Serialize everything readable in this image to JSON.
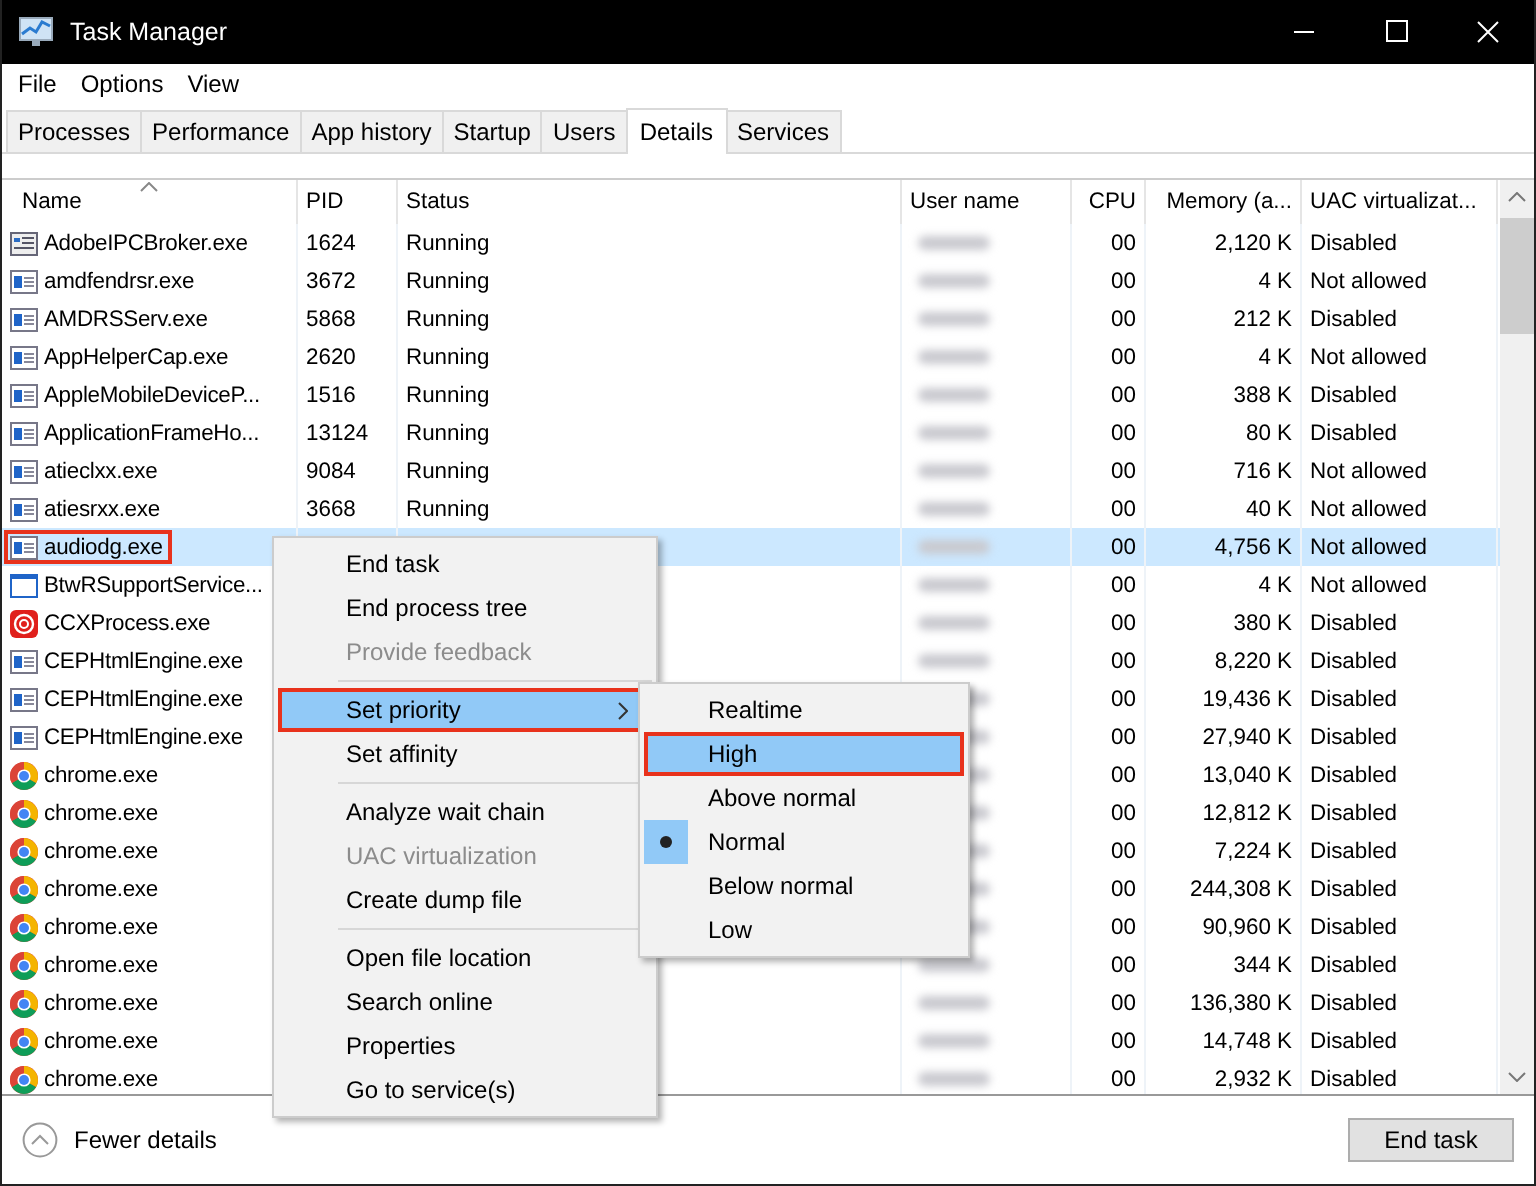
{
  "window": {
    "title": "Task Manager"
  },
  "menu_bar": [
    "File",
    "Options",
    "View"
  ],
  "tabs": [
    {
      "label": "Processes",
      "selected": false
    },
    {
      "label": "Performance",
      "selected": false
    },
    {
      "label": "App history",
      "selected": false
    },
    {
      "label": "Startup",
      "selected": false
    },
    {
      "label": "Users",
      "selected": false
    },
    {
      "label": "Details",
      "selected": true
    },
    {
      "label": "Services",
      "selected": false
    }
  ],
  "table": {
    "columns": [
      {
        "label": "Name",
        "sorted": true
      },
      {
        "label": "PID",
        "sorted": false
      },
      {
        "label": "Status",
        "sorted": false
      },
      {
        "label": "User name",
        "sorted": false
      },
      {
        "label": "CPU",
        "sorted": false
      },
      {
        "label": "Memory (a...",
        "sorted": false
      },
      {
        "label": "UAC virtualizat...",
        "sorted": false
      }
    ],
    "rows": [
      {
        "kind": "service",
        "name": "AdobeIPCBroker.exe",
        "pid": "1624",
        "status": "Running",
        "cpu": "00",
        "memory": "2,120 K",
        "uac": "Disabled",
        "selected": false,
        "outlined": false
      },
      {
        "kind": "app",
        "name": "amdfendrsr.exe",
        "pid": "3672",
        "status": "Running",
        "cpu": "00",
        "memory": "4 K",
        "uac": "Not allowed",
        "selected": false,
        "outlined": false
      },
      {
        "kind": "app",
        "name": "AMDRSServ.exe",
        "pid": "5868",
        "status": "Running",
        "cpu": "00",
        "memory": "212 K",
        "uac": "Disabled",
        "selected": false,
        "outlined": false
      },
      {
        "kind": "app",
        "name": "AppHelperCap.exe",
        "pid": "2620",
        "status": "Running",
        "cpu": "00",
        "memory": "4 K",
        "uac": "Not allowed",
        "selected": false,
        "outlined": false
      },
      {
        "kind": "app",
        "name": "AppleMobileDeviceP...",
        "pid": "1516",
        "status": "Running",
        "cpu": "00",
        "memory": "388 K",
        "uac": "Disabled",
        "selected": false,
        "outlined": false
      },
      {
        "kind": "app",
        "name": "ApplicationFrameHo...",
        "pid": "13124",
        "status": "Running",
        "cpu": "00",
        "memory": "80 K",
        "uac": "Disabled",
        "selected": false,
        "outlined": false
      },
      {
        "kind": "app",
        "name": "atieclxx.exe",
        "pid": "9084",
        "status": "Running",
        "cpu": "00",
        "memory": "716 K",
        "uac": "Not allowed",
        "selected": false,
        "outlined": false
      },
      {
        "kind": "app",
        "name": "atiesrxx.exe",
        "pid": "3668",
        "status": "Running",
        "cpu": "00",
        "memory": "40 K",
        "uac": "Not allowed",
        "selected": false,
        "outlined": false
      },
      {
        "kind": "app",
        "name": "audiodg.exe",
        "cpu": "00",
        "memory": "4,756 K",
        "uac": "Not allowed",
        "selected": true,
        "outlined": true
      },
      {
        "kind": "window",
        "name": "BtwRSupportService...",
        "cpu": "00",
        "memory": "4 K",
        "uac": "Not allowed",
        "selected": false,
        "outlined": false
      },
      {
        "kind": "ccx",
        "name": "CCXProcess.exe",
        "cpu": "00",
        "memory": "380 K",
        "uac": "Disabled",
        "selected": false,
        "outlined": false
      },
      {
        "kind": "app",
        "name": "CEPHtmlEngine.exe",
        "cpu": "00",
        "memory": "8,220 K",
        "uac": "Disabled",
        "selected": false,
        "outlined": false
      },
      {
        "kind": "app",
        "name": "CEPHtmlEngine.exe",
        "cpu": "00",
        "memory": "19,436 K",
        "uac": "Disabled",
        "selected": false,
        "outlined": false
      },
      {
        "kind": "app",
        "name": "CEPHtmlEngine.exe",
        "cpu": "00",
        "memory": "27,940 K",
        "uac": "Disabled",
        "selected": false,
        "outlined": false
      },
      {
        "kind": "chrome",
        "name": "chrome.exe",
        "cpu": "00",
        "memory": "13,040 K",
        "uac": "Disabled",
        "selected": false,
        "outlined": false
      },
      {
        "kind": "chrome",
        "name": "chrome.exe",
        "cpu": "00",
        "memory": "12,812 K",
        "uac": "Disabled",
        "selected": false,
        "outlined": false
      },
      {
        "kind": "chrome",
        "name": "chrome.exe",
        "cpu": "00",
        "memory": "7,224 K",
        "uac": "Disabled",
        "selected": false,
        "outlined": false
      },
      {
        "kind": "chrome",
        "name": "chrome.exe",
        "cpu": "00",
        "memory": "244,308 K",
        "uac": "Disabled",
        "selected": false,
        "outlined": false
      },
      {
        "kind": "chrome",
        "name": "chrome.exe",
        "cpu": "00",
        "memory": "90,960 K",
        "uac": "Disabled",
        "selected": false,
        "outlined": false
      },
      {
        "kind": "chrome",
        "name": "chrome.exe",
        "cpu": "00",
        "memory": "344 K",
        "uac": "Disabled",
        "selected": false,
        "outlined": false
      },
      {
        "kind": "chrome",
        "name": "chrome.exe",
        "cpu": "00",
        "memory": "136,380 K",
        "uac": "Disabled",
        "selected": false,
        "outlined": false
      },
      {
        "kind": "chrome",
        "name": "chrome.exe",
        "cpu": "00",
        "memory": "14,748 K",
        "uac": "Disabled",
        "selected": false,
        "outlined": false
      },
      {
        "kind": "chrome",
        "name": "chrome.exe",
        "cpu": "00",
        "memory": "2,932 K",
        "uac": "Disabled",
        "selected": false,
        "outlined": false
      }
    ]
  },
  "context_menu": {
    "items": [
      {
        "kind": "item",
        "label": "End task",
        "disabled": false,
        "highlighted": false,
        "outlined": false
      },
      {
        "kind": "item",
        "label": "End process tree",
        "disabled": false,
        "highlighted": false,
        "outlined": false
      },
      {
        "kind": "item",
        "label": "Provide feedback",
        "disabled": true,
        "highlighted": false,
        "outlined": false
      },
      {
        "kind": "separator"
      },
      {
        "kind": "submenu",
        "label": "Set priority",
        "disabled": false,
        "highlighted": true,
        "outlined": true
      },
      {
        "kind": "item",
        "label": "Set affinity",
        "disabled": false,
        "highlighted": false,
        "outlined": false
      },
      {
        "kind": "separator"
      },
      {
        "kind": "item",
        "label": "Analyze wait chain",
        "disabled": false,
        "highlighted": false,
        "outlined": false
      },
      {
        "kind": "item",
        "label": "UAC virtualization",
        "disabled": true,
        "highlighted": false,
        "outlined": false
      },
      {
        "kind": "item",
        "label": "Create dump file",
        "disabled": false,
        "highlighted": false,
        "outlined": false
      },
      {
        "kind": "separator"
      },
      {
        "kind": "item",
        "label": "Open file location",
        "disabled": false,
        "highlighted": false,
        "outlined": false
      },
      {
        "kind": "item",
        "label": "Search online",
        "disabled": false,
        "highlighted": false,
        "outlined": false
      },
      {
        "kind": "item",
        "label": "Properties",
        "disabled": false,
        "highlighted": false,
        "outlined": false
      },
      {
        "kind": "item",
        "label": "Go to service(s)",
        "disabled": false,
        "highlighted": false,
        "outlined": false
      }
    ]
  },
  "priority_submenu": {
    "items": [
      {
        "label": "Realtime",
        "selected": false,
        "highlighted": false,
        "outlined": false
      },
      {
        "label": "High",
        "selected": false,
        "highlighted": true,
        "outlined": true
      },
      {
        "label": "Above normal",
        "selected": false,
        "highlighted": false,
        "outlined": false
      },
      {
        "label": "Normal",
        "selected": true,
        "highlighted": false,
        "outlined": false
      },
      {
        "label": "Below normal",
        "selected": false,
        "highlighted": false,
        "outlined": false
      },
      {
        "label": "Low",
        "selected": false,
        "highlighted": false,
        "outlined": false
      }
    ]
  },
  "footer": {
    "toggle_label": "Fewer details",
    "button": "End task"
  }
}
